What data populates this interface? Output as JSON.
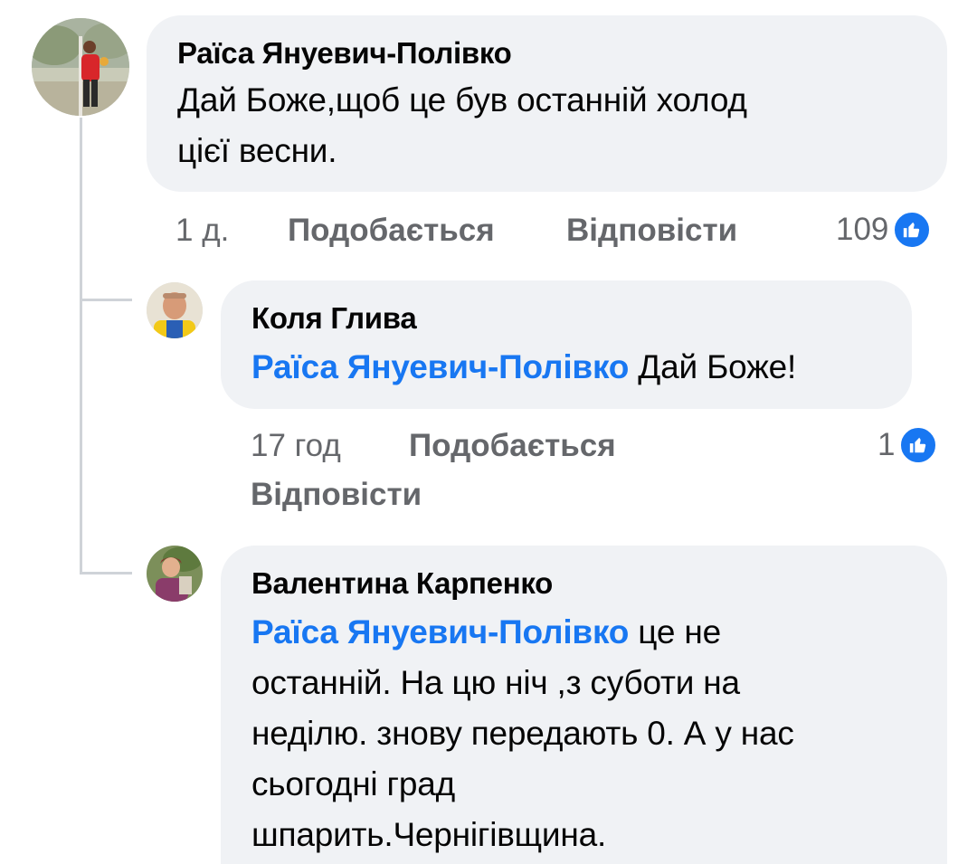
{
  "comments": [
    {
      "author": "Раїса Януевич-Полівко",
      "text_line1": "Дай Боже,щоб це був останній холод",
      "text_line2": "цієї весни.",
      "time": "1 д.",
      "like_label": "Подобається",
      "reply_label": "Відповісти",
      "like_count": "109"
    },
    {
      "author": "Коля Глива",
      "mention": "Раїса Януевич-Полівко",
      "text": "Дай Боже!",
      "time": "17 год",
      "like_label": "Подобається",
      "reply_label": "Відповісти",
      "like_count": "1"
    },
    {
      "author": "Валентина Карпенко",
      "mention": "Раїса Януевич-Полівко",
      "text_line1": "це не",
      "text_line2": "останній. На цю ніч ,з суботи на",
      "text_line3": "неділю. знову передають 0. А у нас",
      "text_line4": "сьогодні град",
      "text_line5": "шпарить.Чернігівщина."
    }
  ],
  "colors": {
    "bubble": "#f0f2f5",
    "mention": "#1877f2",
    "meta": "#65676b",
    "like_badge": "#1877f2"
  },
  "icons": [
    "like-thumb-icon"
  ]
}
